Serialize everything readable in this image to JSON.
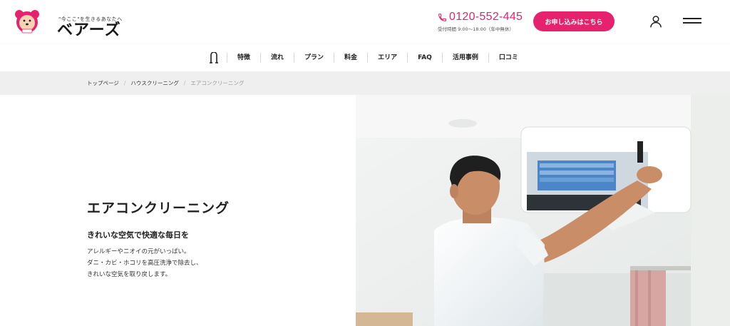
{
  "header": {
    "logo_tagline": "\"今ここ\"を生きるあなたへ",
    "logo_text": "ベアーズ",
    "phone_number": "0120-552-445",
    "phone_hours": "受付時間 9:00〜18:00（年中無休）",
    "apply_label": "お申し込みはこちら",
    "brand_color": "#e6226e"
  },
  "nav": {
    "items": [
      "特徴",
      "流れ",
      "プラン",
      "料金",
      "エリア",
      "FAQ",
      "活用事例",
      "口コミ"
    ]
  },
  "breadcrumb": {
    "items": [
      "トップページ",
      "ハウスクリーニング"
    ],
    "current": "エアコンクリーニング"
  },
  "hero": {
    "title": "エアコンクリーニング",
    "subtitle": "きれいな空気で快適な毎日を",
    "description": [
      "アレルギーやニオイの元がいっぱい。",
      "ダニ・カビ・ホコリを高圧洗浄で除去し、",
      "きれいな空気を取り戻します。"
    ]
  }
}
